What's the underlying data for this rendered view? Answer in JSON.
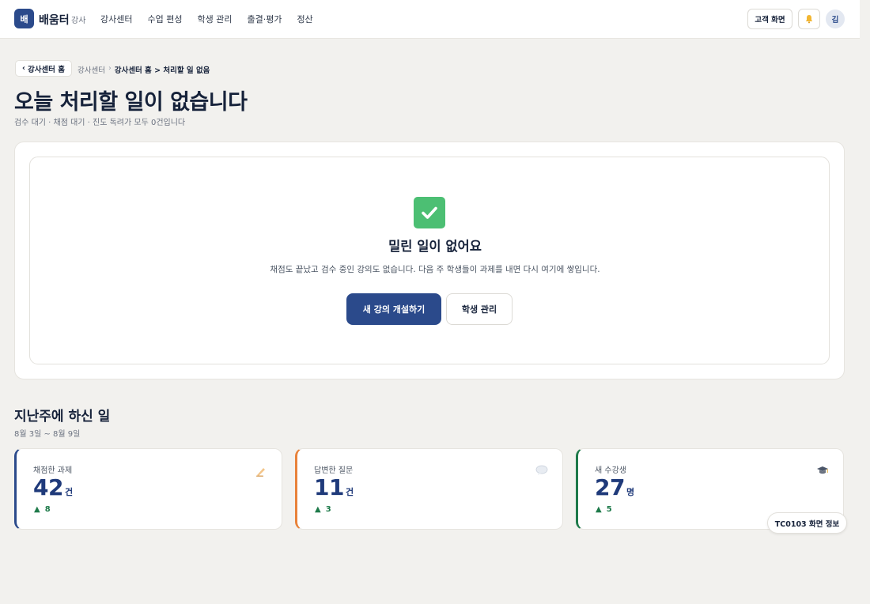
{
  "header": {
    "logo_char": "배",
    "brand": "배움터",
    "brand_sub": "강사",
    "nav": [
      "강사센터",
      "수업 편성",
      "학생 관리",
      "출결·평가",
      "정산"
    ],
    "customer_view": "고객 화면",
    "bell_icon": "bell-icon",
    "avatar": "김"
  },
  "breadcrumb": {
    "back_label": "강사센터 홈",
    "root": "강사센터",
    "sep": "›",
    "current": "강사센터 홈 > 처리할 일 없음"
  },
  "page": {
    "title": "오늘 처리할 일이 없습니다",
    "subtitle": "검수 대기 · 채점 대기 · 진도 독려가 모두 0건입니다"
  },
  "empty_state": {
    "icon": "check-mark-icon",
    "title": "밀린 일이 없어요",
    "description": "채점도 끝났고 검수 중인 강의도 없습니다. 다음 주 학생들이 과제를 내면 다시 여기에 쌓입니다.",
    "primary_action": "새 강의 개설하기",
    "secondary_action": "학생 관리"
  },
  "last_week": {
    "title": "지난주에 하신 일",
    "range": "8월 3일 ~ 8월 9일",
    "stats": [
      {
        "label": "채점한 과제",
        "value": "42",
        "unit": "건",
        "delta": "8",
        "icon": "writing-hand-icon",
        "accent": "#2b4a8b"
      },
      {
        "label": "답변한 질문",
        "value": "11",
        "unit": "건",
        "delta": "3",
        "icon": "speech-bubble-icon",
        "accent": "#e8823a"
      },
      {
        "label": "새 수강생",
        "value": "27",
        "unit": "명",
        "delta": "5",
        "icon": "graduation-cap-icon",
        "accent": "#1e7a4a"
      }
    ]
  },
  "screen_badge": "TC0103 화면 정보",
  "colors": {
    "primary": "#2b4a8b",
    "background": "#f2f1ee",
    "success": "#4cbf73"
  }
}
